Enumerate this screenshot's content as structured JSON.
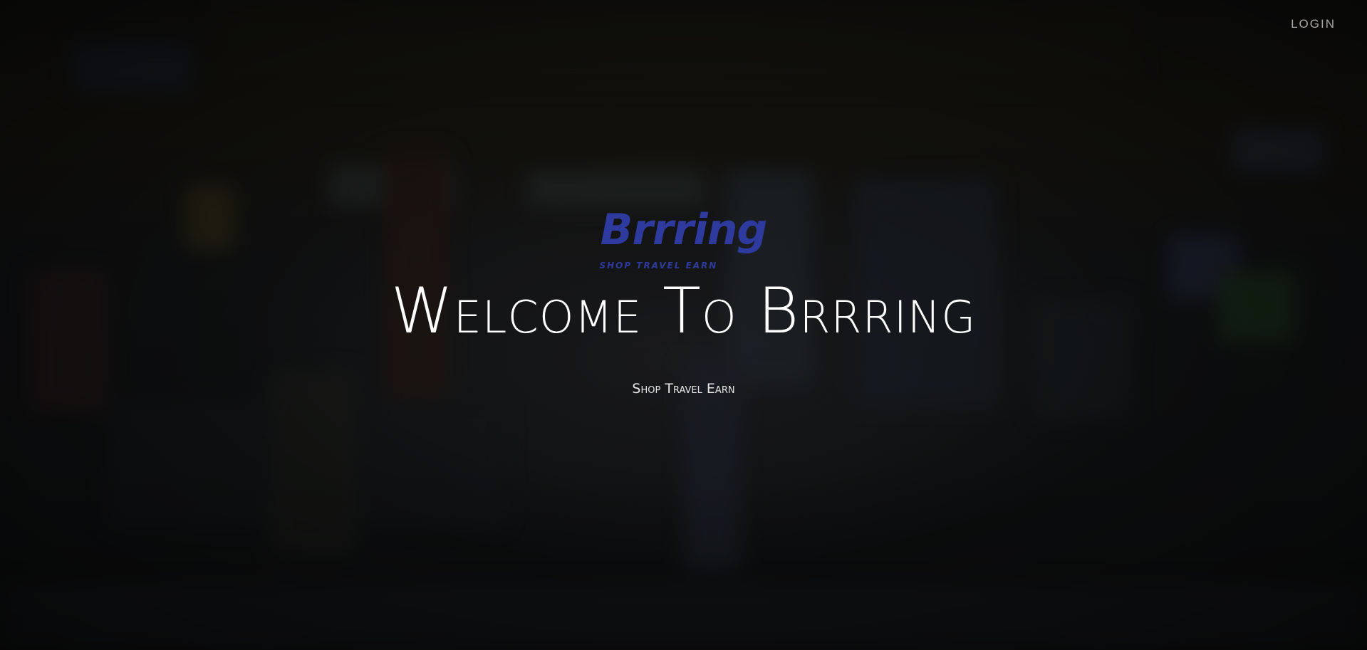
{
  "nav": {
    "login_label": "LOGIN"
  },
  "logo": {
    "wordmark": "Brrring",
    "tagline": "SHOP TRAVEL EARN",
    "color": "#2e3a9e"
  },
  "hero": {
    "headline": "Welcome To Brrring",
    "subheadline": "Shop Travel Earn"
  },
  "colors": {
    "text": "#ffffff",
    "login": "#a9a9a9",
    "brand": "#2e3a9e"
  }
}
